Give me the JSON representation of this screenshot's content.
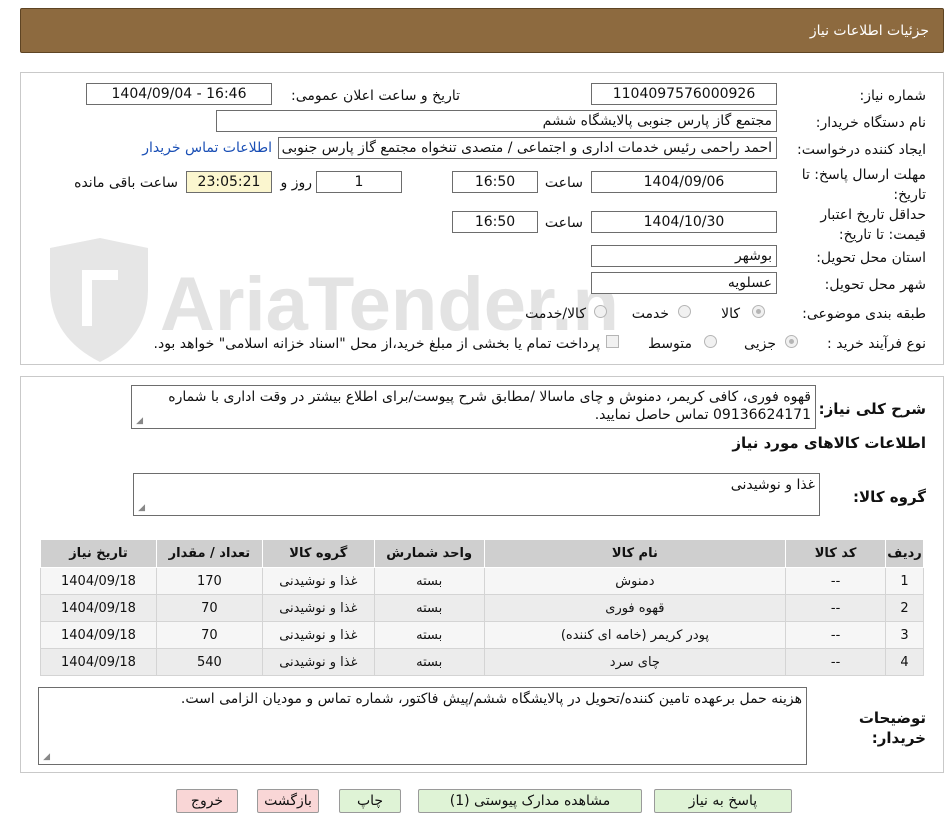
{
  "header": {
    "title": "جزئیات اطلاعات نیاز"
  },
  "watermark": {
    "text": "AriaTender.neT"
  },
  "fields": {
    "need_number": {
      "label": "شماره نیاز:",
      "value": "1104097576000926"
    },
    "announce": {
      "label": "تاریخ و ساعت اعلان عمومی:",
      "value": "1404/09/04 - 16:46"
    },
    "buyer_org": {
      "label": "نام دستگاه خریدار:",
      "value": "مجتمع گاز پارس جنوبی  پالایشگاه ششم"
    },
    "requester": {
      "label": "ایجاد کننده درخواست:",
      "value": "احمد راحمی رئیس خدمات اداری و اجتماعی / متصدی تنخواه مجتمع گاز پارس جنوبی",
      "link": "اطلاعات تماس خریدار"
    },
    "reply_deadline": {
      "label": "مهلت ارسال پاسخ: تا تاریخ:",
      "date": "1404/09/06",
      "time_label": "ساعت",
      "time": "16:50",
      "days": "1",
      "days_label": "روز و",
      "remaining": "23:05:21",
      "remaining_label": "ساعت باقی مانده"
    },
    "price_validity": {
      "label": "حداقل تاریخ اعتبار قیمت: تا تاریخ:",
      "date": "1404/10/30",
      "time_label": "ساعت",
      "time": "16:50"
    },
    "province": {
      "label": "استان محل تحویل:",
      "value": "بوشهر"
    },
    "city": {
      "label": "شهر محل تحویل:",
      "value": "عسلویه"
    },
    "category": {
      "label": "طبقه بندی موضوعی:",
      "options": [
        "کالا",
        "خدمت",
        "کالا/خدمت"
      ],
      "selected": "کالا"
    },
    "process": {
      "label": "نوع فرآیند خرید :",
      "options": [
        "جزیی",
        "متوسط"
      ],
      "selected": "جزیی",
      "checkbox_text": "پرداخت تمام یا بخشی از مبلغ خرید،از محل \"اسناد خزانه اسلامی\" خواهد بود."
    }
  },
  "description": {
    "label": "شرح کلی نیاز:",
    "value": "قهوه فوری، کافی کریمر، دمنوش و چای ماسالا /مطابق شرح پیوست/برای اطلاع بیشتر در وقت اداری با شماره 09136624171 تماس حاصل نمایید."
  },
  "goods_section": {
    "title": "اطلاعات کالاهای مورد نیاز"
  },
  "goods_group": {
    "label": "گروه کالا:",
    "value": "غذا و نوشیدنی"
  },
  "table": {
    "headers": [
      "ردیف",
      "کد کالا",
      "نام کالا",
      "واحد شمارش",
      "گروه کالا",
      "تعداد / مقدار",
      "تاریخ نیاز"
    ],
    "rows": [
      [
        "1",
        "--",
        "دمنوش",
        "بسته",
        "غذا و نوشیدنی",
        "170",
        "1404/09/18"
      ],
      [
        "2",
        "--",
        "قهوه فوری",
        "بسته",
        "غذا و نوشیدنی",
        "70",
        "1404/09/18"
      ],
      [
        "3",
        "--",
        "پودر کریمر (خامه ای کننده)",
        "بسته",
        "غذا و نوشیدنی",
        "70",
        "1404/09/18"
      ],
      [
        "4",
        "--",
        "چای سرد",
        "بسته",
        "غذا و نوشیدنی",
        "540",
        "1404/09/18"
      ]
    ]
  },
  "buyer_notes": {
    "label": "توضیحات خریدار:",
    "value": "هزینه حمل برعهده تامین کننده/تحویل در پالایشگاه ششم/پیش فاکتور، شماره تماس و مودیان الزامی است."
  },
  "buttons": {
    "reply": "پاسخ به نیاز",
    "attachments": "مشاهده مدارک پیوستی (1)",
    "print": "چاپ",
    "back": "بازگشت",
    "exit": "خروج"
  }
}
